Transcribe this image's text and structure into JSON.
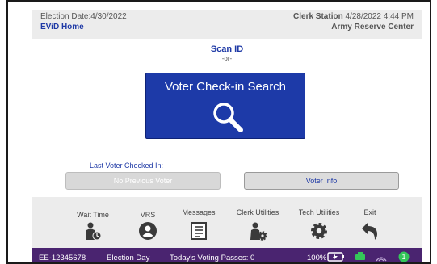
{
  "header": {
    "election_date": "Election Date:4/30/2022",
    "home": "EViD Home",
    "station_label": "Clerk Station",
    "station_datetime": "4/28/2022 4:44 PM",
    "location": "Army Reserve Center"
  },
  "main": {
    "scan_id": "Scan ID",
    "or": "-or-",
    "search_button_label": "Voter Check-in Search",
    "last_voter_label": "Last Voter Checked In:",
    "no_previous_voter": "No Previous Voter",
    "voter_info": "Voter Info"
  },
  "toolbar": {
    "items": [
      {
        "label": "Wait Time",
        "icon": "person-clock-icon"
      },
      {
        "label": "VRS",
        "icon": "person-circle-icon"
      },
      {
        "label": "Messages",
        "icon": "messages-icon"
      },
      {
        "label": "Clerk Utilities",
        "icon": "person-gear-icon"
      },
      {
        "label": "Tech Utilities",
        "icon": "gear-icon"
      },
      {
        "label": "Exit",
        "icon": "exit-arrow-icon"
      }
    ]
  },
  "status": {
    "device_id": "EE-12345678",
    "mode": "Election Day",
    "passes": "Today's Voting Passes: 0",
    "battery": "100%",
    "notification_count": "1"
  },
  "colors": {
    "accent_blue": "#1d3aa8",
    "status_bar": "#4a2470",
    "notification_green": "#34c759"
  }
}
